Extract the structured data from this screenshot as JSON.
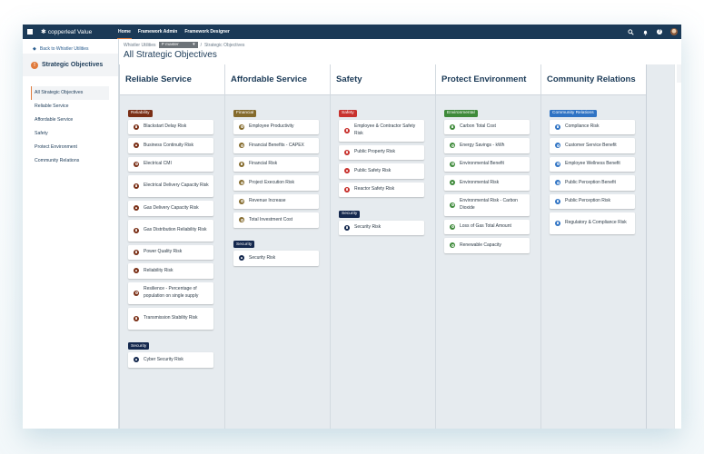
{
  "topbar": {
    "app_name": "copperleaf Value",
    "nav": [
      {
        "label": "Home",
        "active": true
      },
      {
        "label": "Framework Admin",
        "active": false
      },
      {
        "label": "Framework Designer",
        "active": false
      }
    ],
    "icons": [
      "search-icon",
      "bell-icon",
      "help-icon",
      "avatar"
    ],
    "help_glyph": "?"
  },
  "sidebar": {
    "back_label": "Back to Whistler Utilities",
    "section_title": "Strategic Objectives",
    "section_badge": "!",
    "items": [
      {
        "label": "All Strategic Objectives",
        "active": true
      },
      {
        "label": "Reliable Service",
        "active": false
      },
      {
        "label": "Affordable Service",
        "active": false
      },
      {
        "label": "Safety",
        "active": false
      },
      {
        "label": "Protect Environment",
        "active": false
      },
      {
        "label": "Community Relations",
        "active": false
      }
    ]
  },
  "header": {
    "breadcrumb_root": "Whistler Utilities",
    "branch": "master",
    "branch_prefix": "P",
    "breadcrumb_sep": "/",
    "breadcrumb_current": "Strategic Objectives",
    "title": "All Strategic Objectives"
  },
  "colors": {
    "Reliability": "#7a2f16",
    "Financial": "#846a2c",
    "Safety": "#c8322e",
    "Security": "#14284e",
    "Environmental": "#3e8a3a",
    "Community Relations": "#2f73c4"
  },
  "columns": [
    {
      "title": "Reliable Service",
      "groups": [
        {
          "tag": "Reliability",
          "color": "#7a2f16",
          "items": [
            {
              "label": "Blackstart Delay Risk",
              "icon": "risk"
            },
            {
              "label": "Business Continuity Risk",
              "icon": "risk"
            },
            {
              "label": "Electrical CMI",
              "icon": "measure"
            },
            {
              "label": "Electrical Delivery Capacity Risk",
              "icon": "risk"
            },
            {
              "label": "Gas Delivery Capacity Risk",
              "icon": "risk"
            },
            {
              "label": "Gas Distribution Reliability Risk",
              "icon": "risk"
            },
            {
              "label": "Power Quality Risk",
              "icon": "risk"
            },
            {
              "label": "Reliability Risk",
              "icon": "risk"
            },
            {
              "label": "Resilience - Percentage of population on single supply",
              "icon": "measure"
            },
            {
              "label": "Transmission Stability Risk",
              "icon": "risk"
            }
          ]
        },
        {
          "tag": "Security",
          "color": "#14284e",
          "items": [
            {
              "label": "Cyber Security Risk",
              "icon": "risk"
            }
          ]
        }
      ]
    },
    {
      "title": "Affordable Service",
      "groups": [
        {
          "tag": "Financial",
          "color": "#846a2c",
          "items": [
            {
              "label": "Employee Productivity",
              "icon": "benefit"
            },
            {
              "label": "Financial Benefits - CAPEX",
              "icon": "benefit"
            },
            {
              "label": "Financial Risk",
              "icon": "risk"
            },
            {
              "label": "Project Execution Risk",
              "icon": "measure"
            },
            {
              "label": "Revenue Increase",
              "icon": "benefit"
            },
            {
              "label": "Total Investment Cost",
              "icon": "measure"
            }
          ]
        },
        {
          "tag": "Security",
          "color": "#14284e",
          "items": [
            {
              "label": "Security Risk",
              "icon": "risk"
            }
          ]
        }
      ]
    },
    {
      "title": "Safety",
      "groups": [
        {
          "tag": "Safety",
          "color": "#c8322e",
          "items": [
            {
              "label": "Employee & Contractor Safety Risk",
              "icon": "risk"
            },
            {
              "label": "Public Property Risk",
              "icon": "risk"
            },
            {
              "label": "Public Safety Risk",
              "icon": "risk"
            },
            {
              "label": "Reactor Safety Risk",
              "icon": "risk"
            }
          ]
        },
        {
          "tag": "Security",
          "color": "#14284e",
          "items": [
            {
              "label": "Security Risk",
              "icon": "risk"
            }
          ]
        }
      ]
    },
    {
      "title": "Protect Environment",
      "groups": [
        {
          "tag": "Environmental",
          "color": "#3e8a3a",
          "items": [
            {
              "label": "Carbon Total Cost",
              "icon": "risk"
            },
            {
              "label": "Energy Savings - kWh",
              "icon": "benefit"
            },
            {
              "label": "Environmental Benefit",
              "icon": "benefit"
            },
            {
              "label": "Environmental Risk",
              "icon": "risk"
            },
            {
              "label": "Environmental Risk - Carbon Dioxide",
              "icon": "measure"
            },
            {
              "label": "Loss of Gas Total Amount",
              "icon": "measure"
            },
            {
              "label": "Renewable Capacity",
              "icon": "benefit"
            }
          ]
        }
      ]
    },
    {
      "title": "Community Relations",
      "groups": [
        {
          "tag": "Community Relations",
          "color": "#2f73c4",
          "items": [
            {
              "label": "Compliance Risk",
              "icon": "risk"
            },
            {
              "label": "Customer Service Benefit",
              "icon": "benefit"
            },
            {
              "label": "Employee Wellness Benefit",
              "icon": "benefit"
            },
            {
              "label": "Public Perception Benefit",
              "icon": "benefit"
            },
            {
              "label": "Public Perception Risk",
              "icon": "risk"
            },
            {
              "label": "Regulatory & Compliance Risk",
              "icon": "risk"
            }
          ]
        }
      ]
    }
  ],
  "right_panel": {
    "icons": [
      "link-icon",
      "notebook-icon",
      "calendar-icon",
      "zoom-icon"
    ],
    "bottom_icon": "columns-icon"
  }
}
